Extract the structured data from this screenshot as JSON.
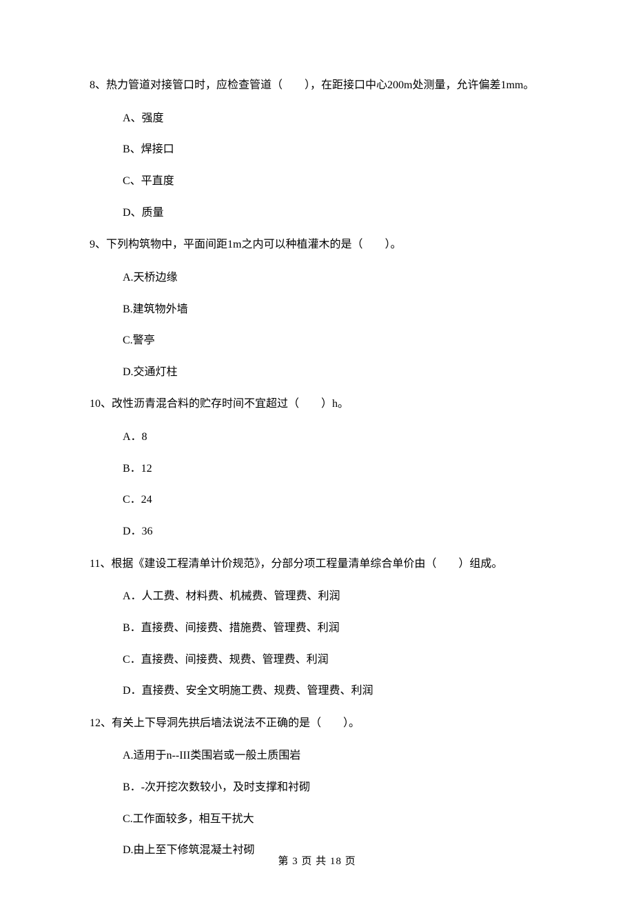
{
  "questions": [
    {
      "number": "8、",
      "text": "热力管道对接管口时，应检查管道（　　），在距接口中心200m处测量，允许偏差1mm。",
      "options": [
        "A、强度",
        "B、焊接口",
        "C、平直度",
        "D、质量"
      ]
    },
    {
      "number": "9、",
      "text": "下列构筑物中，平面间距1m之内可以种植灌木的是（　　）。",
      "options": [
        "A.天桥边缘",
        "B.建筑物外墙",
        "C.警亭",
        "D.交通灯柱"
      ]
    },
    {
      "number": "10、",
      "text": "改性沥青混合料的贮存时间不宜超过（　　）h。",
      "options": [
        "A．8",
        "B．12",
        "C．24",
        "D．36"
      ]
    },
    {
      "number": "11、",
      "text": "根据《建设工程清单计价规范》，分部分项工程量清单综合单价由（　　）组成。",
      "options": [
        "A．人工费、材料费、机械费、管理费、利润",
        "B．直接费、间接费、措施费、管理费、利润",
        "C．直接费、间接费、规费、管理费、利润",
        "D．直接费、安全文明施工费、规费、管理费、利润"
      ]
    },
    {
      "number": "12、",
      "text": "有关上下导洞先拱后墙法说法不正确的是（　　）。",
      "options": [
        "A.适用于n--III类围岩或一般土质围岩",
        "B．-次开挖次数较小，及时支撑和衬砌",
        "C.工作面较多，相互干扰大",
        "D.由上至下修筑混凝土衬砌"
      ]
    }
  ],
  "footer": "第 3 页 共 18 页"
}
